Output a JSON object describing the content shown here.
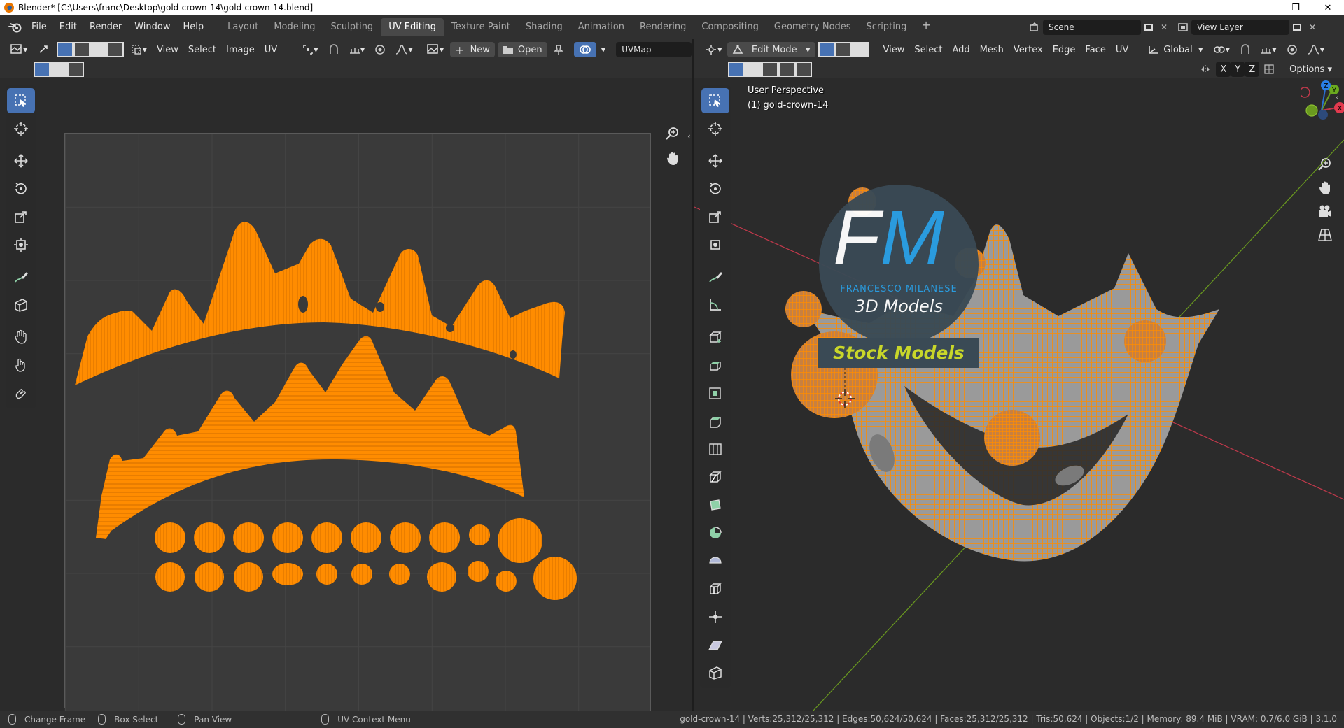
{
  "window": {
    "title": "Blender* [C:\\Users\\franc\\Desktop\\gold-crown-14\\gold-crown-14.blend]",
    "minimize": "—",
    "maximize": "❐",
    "close": "✕"
  },
  "menu": [
    "File",
    "Edit",
    "Render",
    "Window",
    "Help"
  ],
  "workspaces": {
    "tabs": [
      "Layout",
      "Modeling",
      "Sculpting",
      "UV Editing",
      "Texture Paint",
      "Shading",
      "Animation",
      "Rendering",
      "Compositing",
      "Geometry Nodes",
      "Scripting"
    ],
    "active": "UV Editing",
    "add": "+"
  },
  "scene": {
    "name": "Scene",
    "view_layer": "View Layer"
  },
  "uv_editor": {
    "menus": [
      "View",
      "Select",
      "Image",
      "UV"
    ],
    "new_label": "New",
    "open_label": "Open",
    "uvmap": "UVMap"
  },
  "view3d": {
    "mode": "Edit Mode",
    "menus": [
      "View",
      "Select",
      "Add",
      "Mesh",
      "Vertex",
      "Edge",
      "Face",
      "UV"
    ],
    "transform_orientation": "Global",
    "options_label": "Options",
    "axes": [
      "X",
      "Y",
      "Z"
    ],
    "perspective": "User Perspective",
    "object": "(1) gold-crown-14",
    "watermark": {
      "initials_f": "F",
      "initials_m": "M",
      "author": "FRANCESCO MILANESE",
      "models": "3D Models",
      "banner": "Stock Models"
    },
    "gizmo_axes": {
      "x": "X",
      "y": "Y",
      "z": "Z"
    }
  },
  "status": {
    "hints": [
      "Change Frame",
      "Box Select",
      "Pan View",
      "UV Context Menu"
    ],
    "stats": "gold-crown-14 | Verts:25,312/25,312 | Edges:50,624/50,624 | Faces:25,312/25,312 | Tris:50,624 | Objects:1/2 | Memory: 89.4 MiB | VRAM: 0.7/6.0 GiB | 3.1.0"
  },
  "colors": {
    "uv_orange": "#ff8c00",
    "select_blue": "#4772b3",
    "axis_red": "#c0394b",
    "axis_green": "#6a9a1f"
  }
}
